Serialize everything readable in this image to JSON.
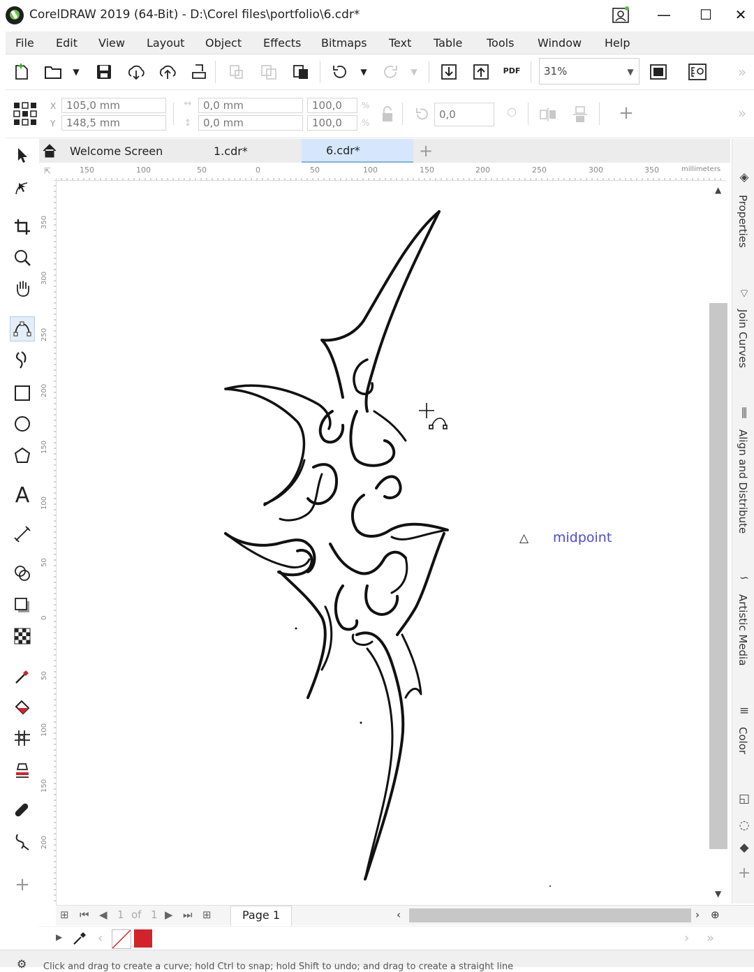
{
  "window": {
    "title": "CorelDRAW 2019 (64-Bit) - D:\\Corel files\\portfolio\\6.cdr*",
    "minimize": "—",
    "maximize": "☐",
    "close": "✕"
  },
  "menu": [
    "File",
    "Edit",
    "View",
    "Layout",
    "Object",
    "Effects",
    "Bitmaps",
    "Text",
    "Table",
    "Tools",
    "Window",
    "Help"
  ],
  "toolbar": {
    "zoom_value": "31%",
    "pdf_label": "PDF",
    "more": "»"
  },
  "properties": {
    "x_label": "X",
    "y_label": "Y",
    "x_value": "105,0 mm",
    "y_value": "148,5 mm",
    "width_value": "0,0 mm",
    "height_value": "0,0 mm",
    "scale_x": "100,0",
    "scale_y": "100,0",
    "percent": "%",
    "rotation": "0,0",
    "add": "+",
    "more": "»"
  },
  "tabs": [
    {
      "label": "Welcome Screen"
    },
    {
      "label": "1.cdr*"
    },
    {
      "label": "6.cdr*",
      "active": true
    }
  ],
  "tab_add": "+",
  "tab_close": "✕",
  "ruler": {
    "units": "millimeters",
    "h_ticks": [
      "150",
      "100",
      "50",
      "0",
      "50",
      "100",
      "150",
      "200",
      "250",
      "300",
      "350"
    ],
    "v_ticks": [
      "350",
      "300",
      "250",
      "200",
      "150",
      "100",
      "50",
      "0",
      "50",
      "100",
      "150",
      "200"
    ]
  },
  "canvas": {
    "snap_label": "midpoint",
    "snap_icon": "△",
    "accent": "#4a4ad6"
  },
  "docker": {
    "tabs": [
      "Properties",
      "Join Curves",
      "Align and Distribute",
      "Artistic Media",
      "Color"
    ],
    "add": "+"
  },
  "page_nav": {
    "current": "1",
    "of": "of",
    "total": "1",
    "page_tab": "Page 1"
  },
  "color_bar": {
    "fill_color": "#d2232a"
  },
  "status": {
    "text": "Click and drag to create a curve; hold Ctrl to snap; hold Shift to undo; and drag to create a straight line"
  }
}
